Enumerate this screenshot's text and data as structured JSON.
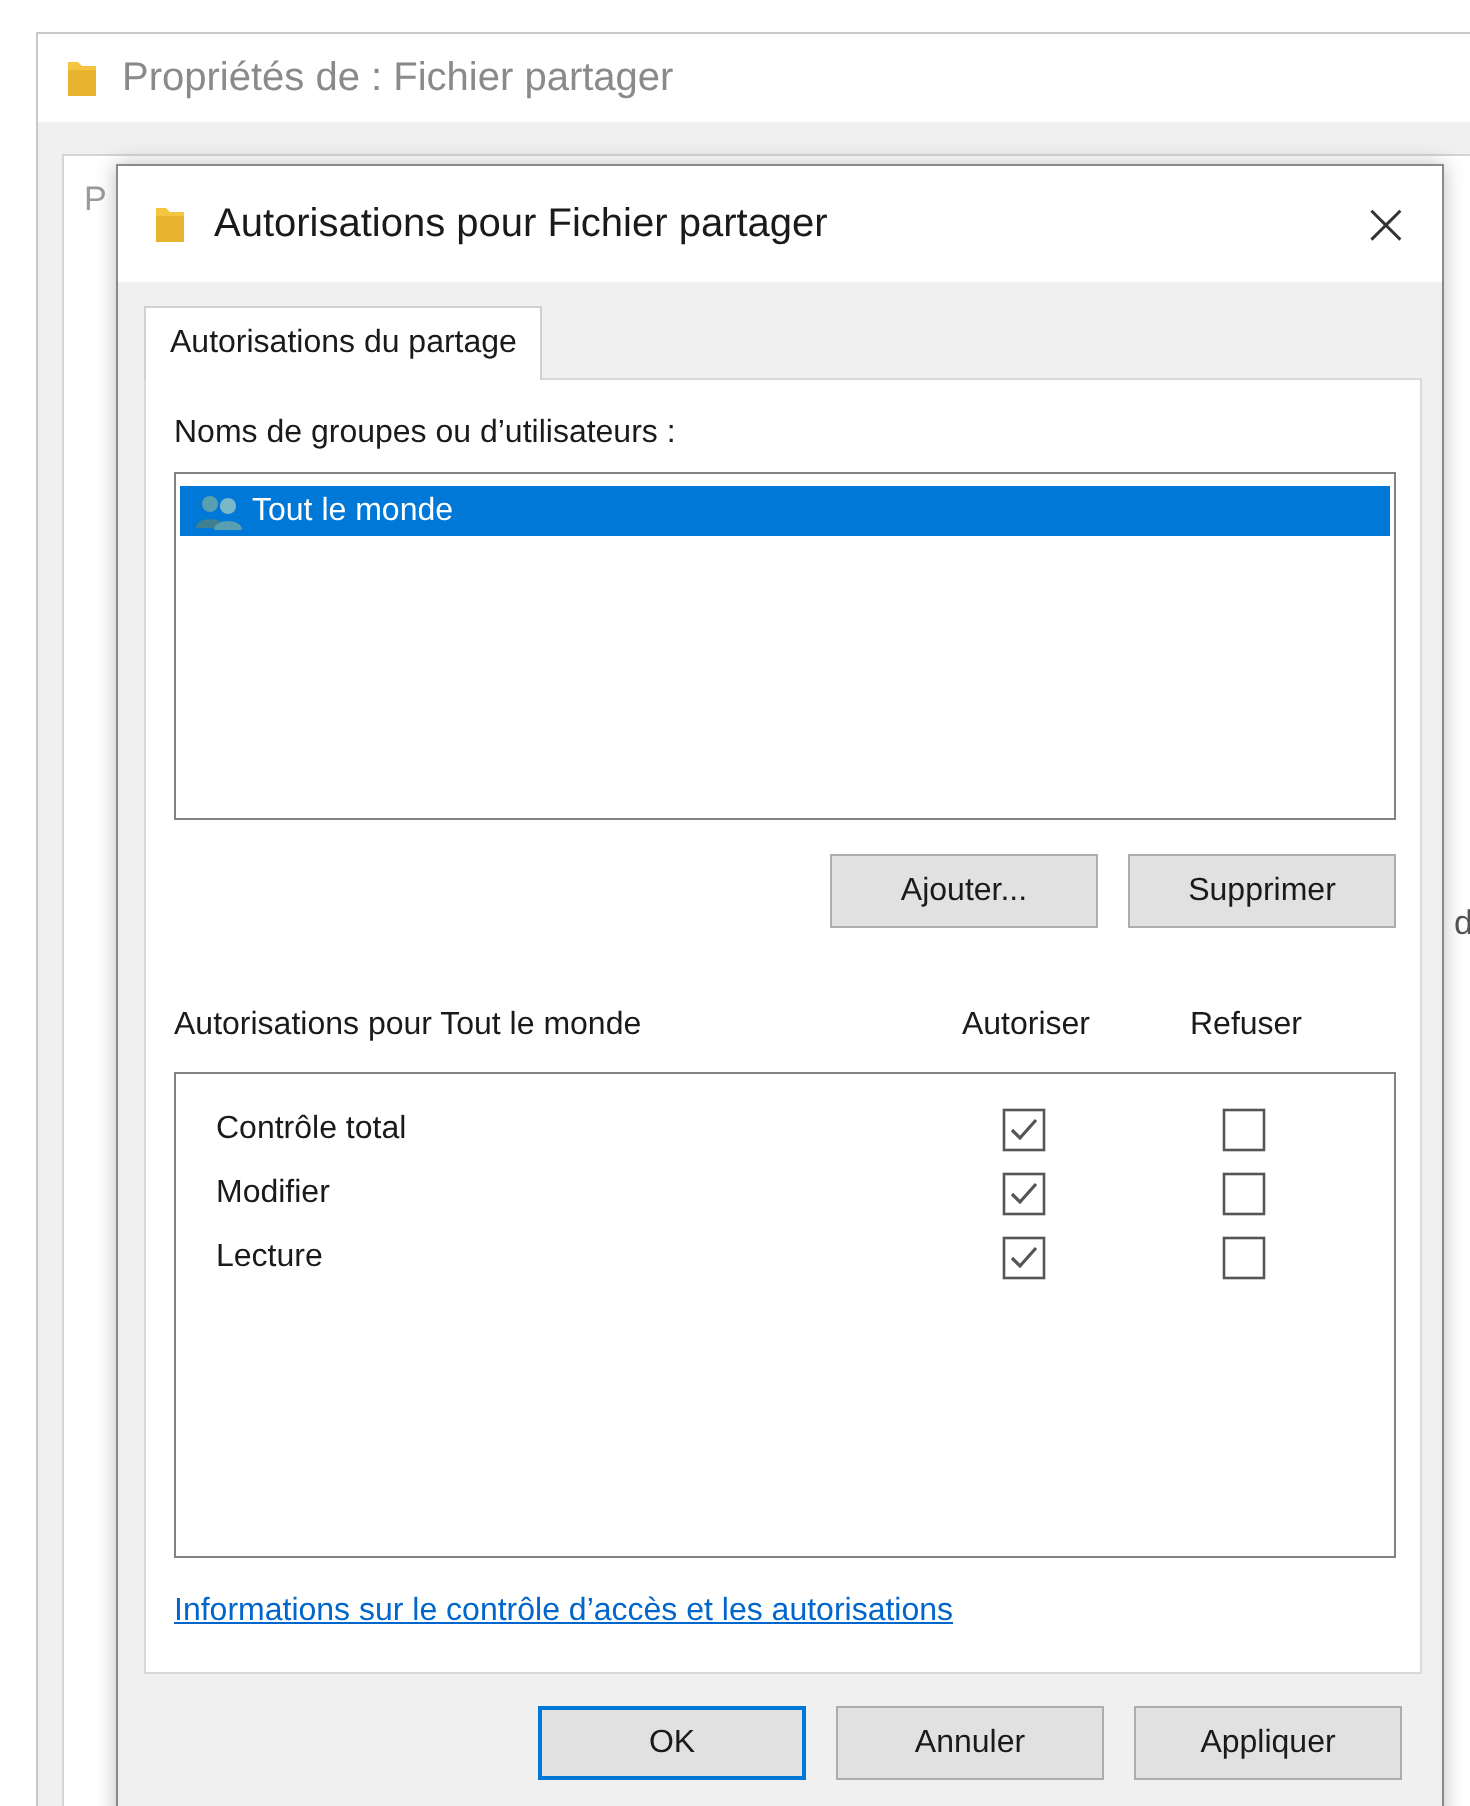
{
  "background_window": {
    "title": "Propriétés de : Fichier partager",
    "tab_fragment": "P",
    "side_fragment": "d"
  },
  "dialog": {
    "title": "Autorisations pour Fichier partager",
    "close": "×",
    "tabs": [
      {
        "label": "Autorisations du partage",
        "selected": true
      }
    ],
    "groups_label": "Noms de groupes ou d’utilisateurs :",
    "groups": [
      {
        "name": "Tout le monde",
        "selected": true
      }
    ],
    "group_buttons": [
      "Ajouter...",
      "Supprimer"
    ],
    "permissions_label": "Autorisations pour Tout le monde",
    "columns": [
      "Autoriser",
      "Refuser"
    ],
    "permissions": [
      {
        "name": "Contrôle total",
        "allow": true,
        "deny": false
      },
      {
        "name": "Modifier",
        "allow": true,
        "deny": false
      },
      {
        "name": "Lecture",
        "allow": true,
        "deny": false
      }
    ],
    "link": "Informations sur le contrôle d’accès et les autorisations",
    "buttons": [
      {
        "label": "OK",
        "default": true
      },
      {
        "label": "Annuler",
        "default": false
      },
      {
        "label": "Appliquer",
        "default": false
      }
    ]
  }
}
